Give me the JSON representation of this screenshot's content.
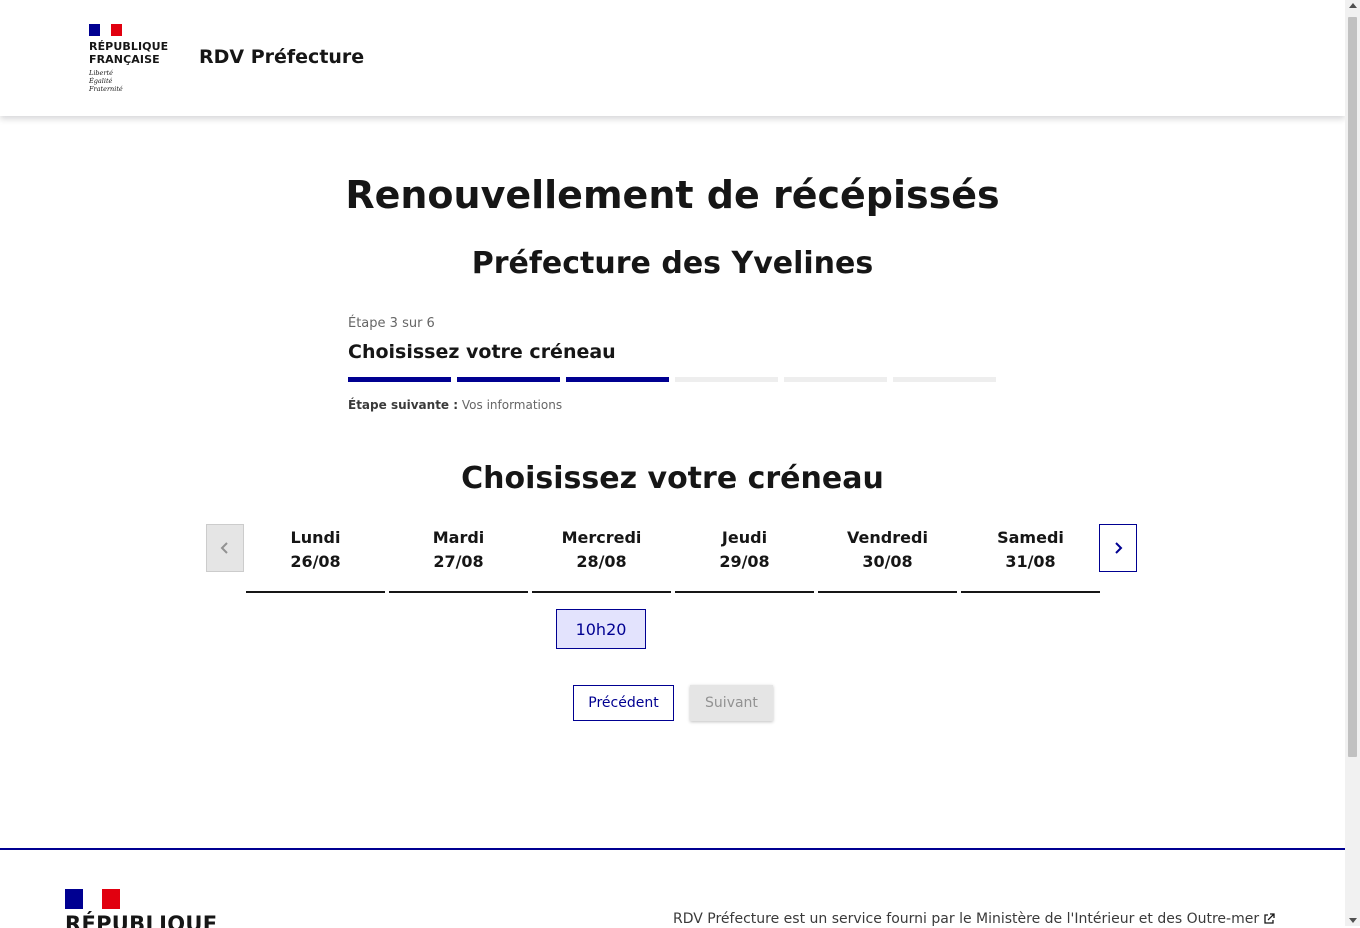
{
  "header": {
    "logo_line1": "RÉPUBLIQUE",
    "logo_line2": "FRANÇAISE",
    "motto": [
      "Liberté",
      "Égalité",
      "Fraternité"
    ],
    "site_name": "RDV Préfecture"
  },
  "main": {
    "title": "Renouvellement de récépissés",
    "subtitle": "Préfecture des Yvelines",
    "stepper": {
      "state": "Étape 3 sur 6",
      "current_step": "Choisissez votre créneau",
      "steps_total": 6,
      "steps_done": 3,
      "next_label": "Étape suivante :",
      "next_value": "Vos informations"
    },
    "section_title": "Choisissez votre créneau",
    "days": [
      {
        "name": "Lundi",
        "date": "26/08"
      },
      {
        "name": "Mardi",
        "date": "27/08"
      },
      {
        "name": "Mercredi",
        "date": "28/08"
      },
      {
        "name": "Jeudi",
        "date": "29/08"
      },
      {
        "name": "Vendredi",
        "date": "30/08"
      },
      {
        "name": "Samedi",
        "date": "31/08"
      }
    ],
    "slot": "10h20",
    "buttons": {
      "previous": "Précédent",
      "next": "Suivant"
    }
  },
  "footer": {
    "brand": "RÉPUBLIQUE",
    "text": "RDV Préfecture est un service fourni par le Ministère de l'Intérieur et des Outre-mer"
  },
  "colors": {
    "primary": "#000091",
    "red": "#e1000f",
    "slot_bg": "#e3e3fd",
    "disabled": "#e5e5e5"
  }
}
